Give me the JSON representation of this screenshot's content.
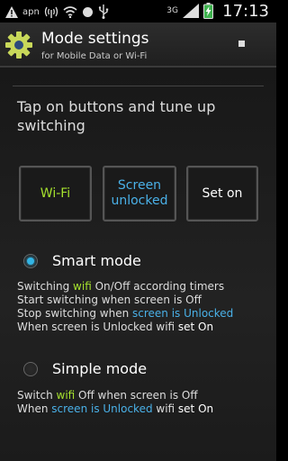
{
  "status_bar": {
    "carrier": "apn",
    "network": "3G",
    "time": "17:13"
  },
  "action_bar": {
    "title": "Mode settings",
    "subtitle": "for Mobile Data or Wi-Fi",
    "icon": "gear-icon"
  },
  "intro": "Tap on buttons and tune up switching",
  "buttons": {
    "wifi": "Wi-Fi",
    "screen_line1": "Screen",
    "screen_line2": "unlocked",
    "seton": "Set on"
  },
  "smart_mode": {
    "label": "Smart mode",
    "selected": true,
    "l1a": "Switching ",
    "l1b": "wifi",
    "l1c": " On/Off according timers",
    "l2": "Start switching when screen is Off",
    "l3a": "Stop switching when ",
    "l3b": "screen is Unlocked",
    "l4a": "When screen is Unlocked wifi ",
    "l4b": "set On"
  },
  "simple_mode": {
    "label": "Simple mode",
    "selected": false,
    "l1a": "Switch ",
    "l1b": "wifi",
    "l1c": " Off when screen is Off",
    "l2a": "When ",
    "l2b": "screen is Unlocked",
    "l2c": " wifi ",
    "l2d": "set On"
  },
  "colors": {
    "accent_green": "#a6e22e",
    "accent_blue": "#4ab1e8",
    "radio_active": "#33b5e5"
  }
}
